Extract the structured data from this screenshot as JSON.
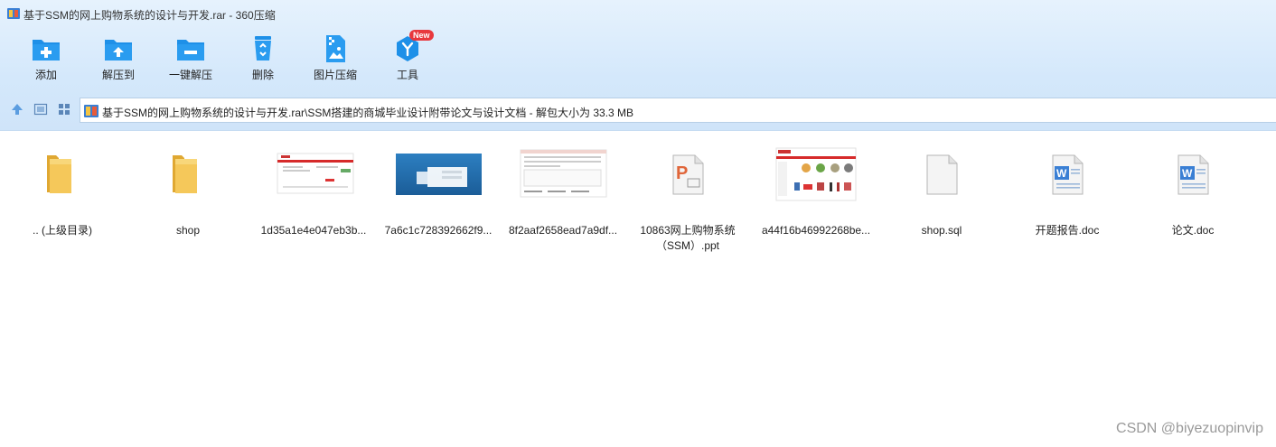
{
  "window": {
    "title": "基于SSM的网上购物系统的设计与开发.rar - 360压缩"
  },
  "toolbar": {
    "items": [
      {
        "label": "添加",
        "icon": "folder-add-icon"
      },
      {
        "label": "解压到",
        "icon": "folder-extract-icon"
      },
      {
        "label": "一键解压",
        "icon": "folder-minus-icon"
      },
      {
        "label": "删除",
        "icon": "recycle-bin-icon"
      },
      {
        "label": "图片压缩",
        "icon": "image-zip-icon"
      },
      {
        "label": "工具",
        "icon": "tools-icon",
        "badge": "New"
      }
    ]
  },
  "address": {
    "path": "基于SSM的网上购物系统的设计与开发.rar\\SSM搭建的商城毕业设计附带论文与设计文档 - 解包大小为 33.3 MB"
  },
  "files": [
    {
      "name": ".. (上级目录)",
      "type": "folder"
    },
    {
      "name": "shop",
      "type": "folder"
    },
    {
      "name": "1d35a1e4e047eb3b...",
      "type": "image"
    },
    {
      "name": "7a6c1c728392662f9...",
      "type": "image"
    },
    {
      "name": "8f2aaf2658ead7a9df...",
      "type": "image"
    },
    {
      "name": "10863网上购物系统（SSM）.ppt",
      "type": "ppt"
    },
    {
      "name": "a44f16b46992268be...",
      "type": "image"
    },
    {
      "name": "shop.sql",
      "type": "file"
    },
    {
      "name": "开题报告.doc",
      "type": "doc"
    },
    {
      "name": "论文.doc",
      "type": "doc"
    }
  ],
  "watermark": "CSDN @biyezuopinvip",
  "colors": {
    "accent": "#1e90e8",
    "folder": "#f5c85a",
    "badge": "#e8383d"
  }
}
